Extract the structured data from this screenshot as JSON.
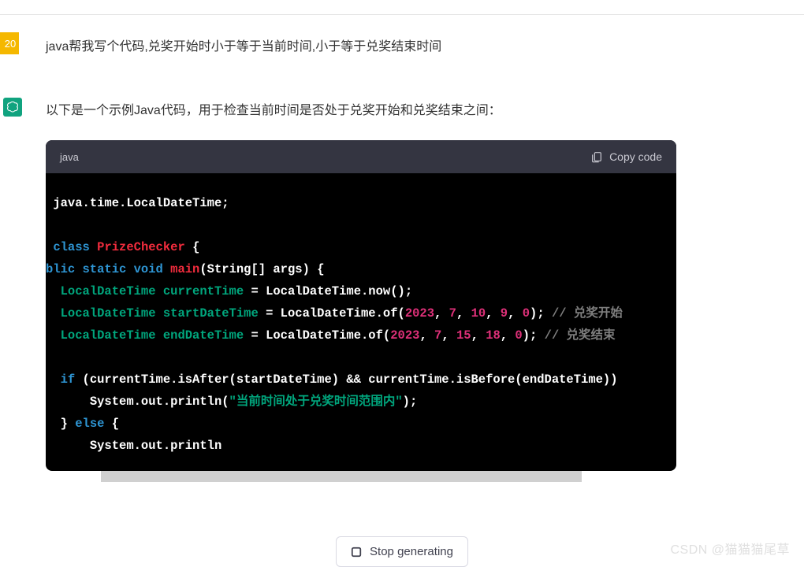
{
  "badge": {
    "value": "20"
  },
  "user": {
    "message": "java帮我写个代码,兑奖开始时小于等于当前时间,小于等于兑奖结束时间"
  },
  "assistant": {
    "intro": "以下是一个示例Java代码，用于检查当前时间是否处于兑奖开始和兑奖结束之间："
  },
  "code": {
    "lang": "java",
    "copy_label": "Copy code",
    "lines": {
      "l1": "java.time.LocalDateTime;",
      "class_kw": "class",
      "class_name": "PrizeChecker",
      "class_open": " {",
      "modifiers": "blic static void",
      "main_name": "main",
      "main_args": "(String[] args)",
      "main_open": " {",
      "var_type": "LocalDateTime",
      "var_cur": "currentTime",
      "var_start": "startDateTime",
      "var_end": "endDateTime",
      "assign": " = ",
      "now_call": "LocalDateTime.now()",
      "of_call": "LocalDateTime.of(",
      "y1": "2023",
      "m1": "7",
      "d1": "10",
      "h1": "9",
      "mm1": "0",
      "y2": "2023",
      "m2": "7",
      "d2": "15",
      "h2": "18",
      "mm2": "0",
      "semi": ";",
      "close_paren": ")",
      "comma": ", ",
      "comment_start": "// 兑奖开始",
      "comment_end": "// 兑奖结束",
      "if_kw": "if",
      "if_cond": " (currentTime.isAfter(startDateTime) && currentTime.isBefore(endDateTime))",
      "println": "System.out.println(",
      "println2": "System.out.println",
      "str1": "\"当前时间处于兑奖时间范围内\"",
      "close_brace": "}",
      "else_kw": "else",
      "open_brace": " {"
    }
  },
  "footer": {
    "stop_label": "Stop generating",
    "watermark": "CSDN @猫猫猫尾草"
  }
}
